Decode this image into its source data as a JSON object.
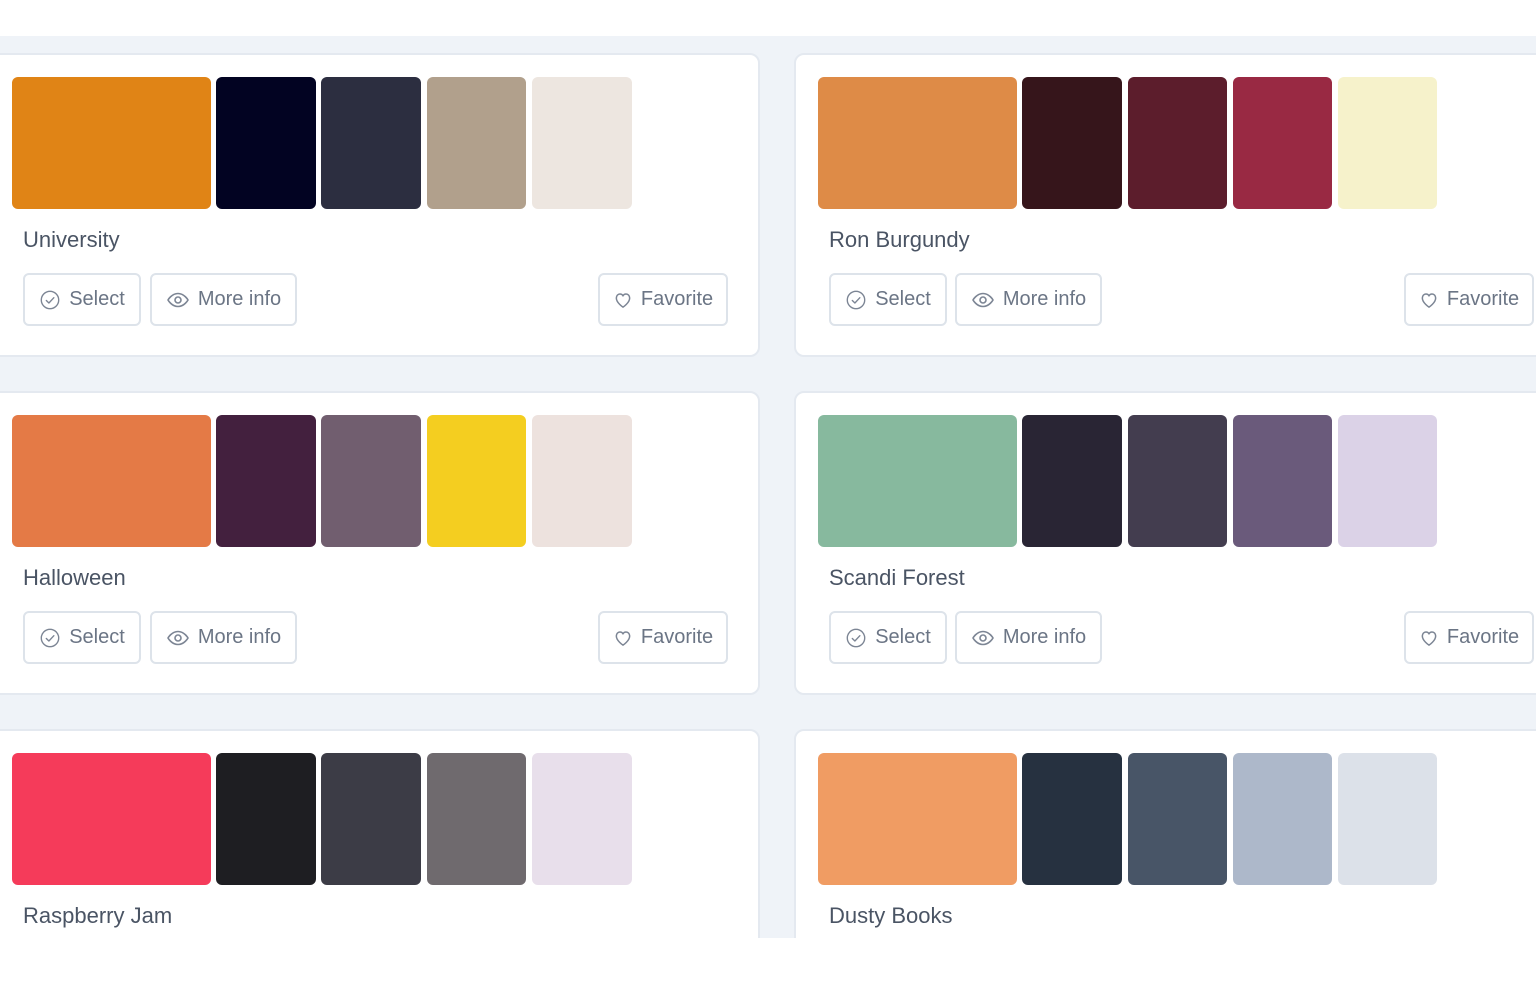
{
  "buttons": {
    "select_label": "Select",
    "more_info_label": "More info",
    "favorite_label": "Favorite"
  },
  "icons": {
    "select": "check-circle-icon",
    "more_info": "eye-icon",
    "favorite": "heart-icon"
  },
  "palettes": [
    {
      "name": "University",
      "colors": [
        "#e08416",
        "#020322",
        "#2c2e40",
        "#b1a08c",
        "#ede6e0"
      ]
    },
    {
      "name": "Ron Burgundy",
      "colors": [
        "#de8b47",
        "#36151b",
        "#5c1d2c",
        "#992943",
        "#f6f2cb"
      ]
    },
    {
      "name": "Halloween",
      "colors": [
        "#e47a46",
        "#43203e",
        "#715e6f",
        "#f4ce20",
        "#ede2de"
      ]
    },
    {
      "name": "Scandi Forest",
      "colors": [
        "#87b99e",
        "#292534",
        "#433d4f",
        "#6a5a7b",
        "#dbd2e7"
      ]
    },
    {
      "name": "Raspberry Jam",
      "colors": [
        "#f53b5a",
        "#1e1e22",
        "#3c3c46",
        "#6f6a6e",
        "#e8dfeb"
      ]
    },
    {
      "name": "Dusty Books",
      "colors": [
        "#f09c63",
        "#263140",
        "#485567",
        "#adb8ca",
        "#dce1e9"
      ]
    }
  ]
}
